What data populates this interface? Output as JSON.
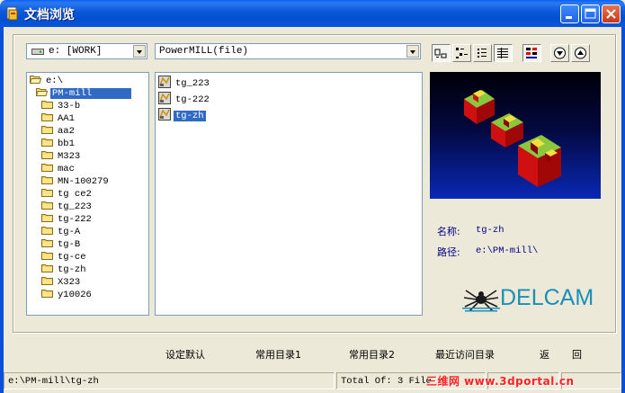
{
  "window": {
    "title": "文档浏览"
  },
  "drive_combo": {
    "value": "e: [WORK]"
  },
  "filter_combo": {
    "value": "PowerMILL(file)"
  },
  "tree": {
    "root": "e:\\",
    "selected": "PM-mill",
    "items": [
      "33-b",
      "AA1",
      "aa2",
      "bb1",
      "M323",
      "mac",
      "MN-100279",
      "tg ce2",
      "tg_223",
      "tg-222",
      "tg-A",
      "tg-B",
      "tg-ce",
      "tg-zh",
      "X323",
      "y10026"
    ]
  },
  "files": [
    {
      "name": "tg_223",
      "selected": false
    },
    {
      "name": "tg-222",
      "selected": false
    },
    {
      "name": "tg-zh",
      "selected": true
    }
  ],
  "info": {
    "name_label": "名称:",
    "name_value": "tg-zh",
    "path_label": "路径:",
    "path_value": "e:\\PM-mill\\"
  },
  "logo": {
    "text": "DELCAM"
  },
  "buttons": {
    "set_default": "设定默认",
    "common_dir1": "常用目录1",
    "common_dir2": "常用目录2",
    "recent_dir": "最近访问目录",
    "back": "返",
    "back2": "回"
  },
  "status": {
    "path": "e:\\PM-mill\\tg-zh",
    "total": "Total Of: 3 File"
  },
  "watermark": "三维网 www.3dportal.cn",
  "colors": {
    "selection": "#316ac5",
    "title_blue": "#0a58d8",
    "logo": "#1a8fb8"
  }
}
